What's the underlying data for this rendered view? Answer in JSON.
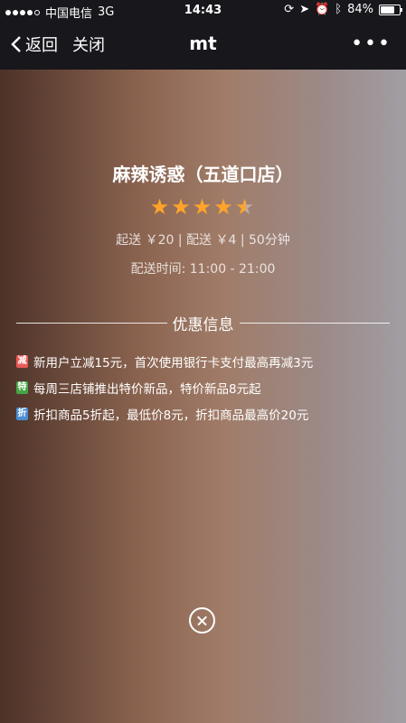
{
  "status_bar": {
    "carrier": "中国电信",
    "network": "3G",
    "time": "14:43",
    "battery": "84%",
    "battery_level": 0.84
  },
  "nav": {
    "back_label": "返回",
    "close_label": "关闭",
    "title": "mt",
    "more_label": "•••"
  },
  "shop": {
    "name": "麻辣诱惑（五道口店）",
    "rating": 4.5,
    "rating_max": 5,
    "delivery_info": "起送 ￥20 | 配送 ￥4 | 50分钟",
    "delivery_time": "配送时间: 11:00 - 21:00"
  },
  "promotions": {
    "title": "优惠信息",
    "items": [
      {
        "badge": "减",
        "color": "#e85a57",
        "text": "新用户立减15元，首次使用银行卡支付最高再减3元"
      },
      {
        "badge": "特",
        "color": "#46a645",
        "text": "每周三店铺推出特价新品，特价新品8元起"
      },
      {
        "badge": "折",
        "color": "#4a8ed6",
        "text": "折扣商品5折起，最低价8元，折扣商品最高价20元"
      }
    ]
  },
  "colors": {
    "header_bg": "#17171c",
    "star": "#ffa42b"
  }
}
